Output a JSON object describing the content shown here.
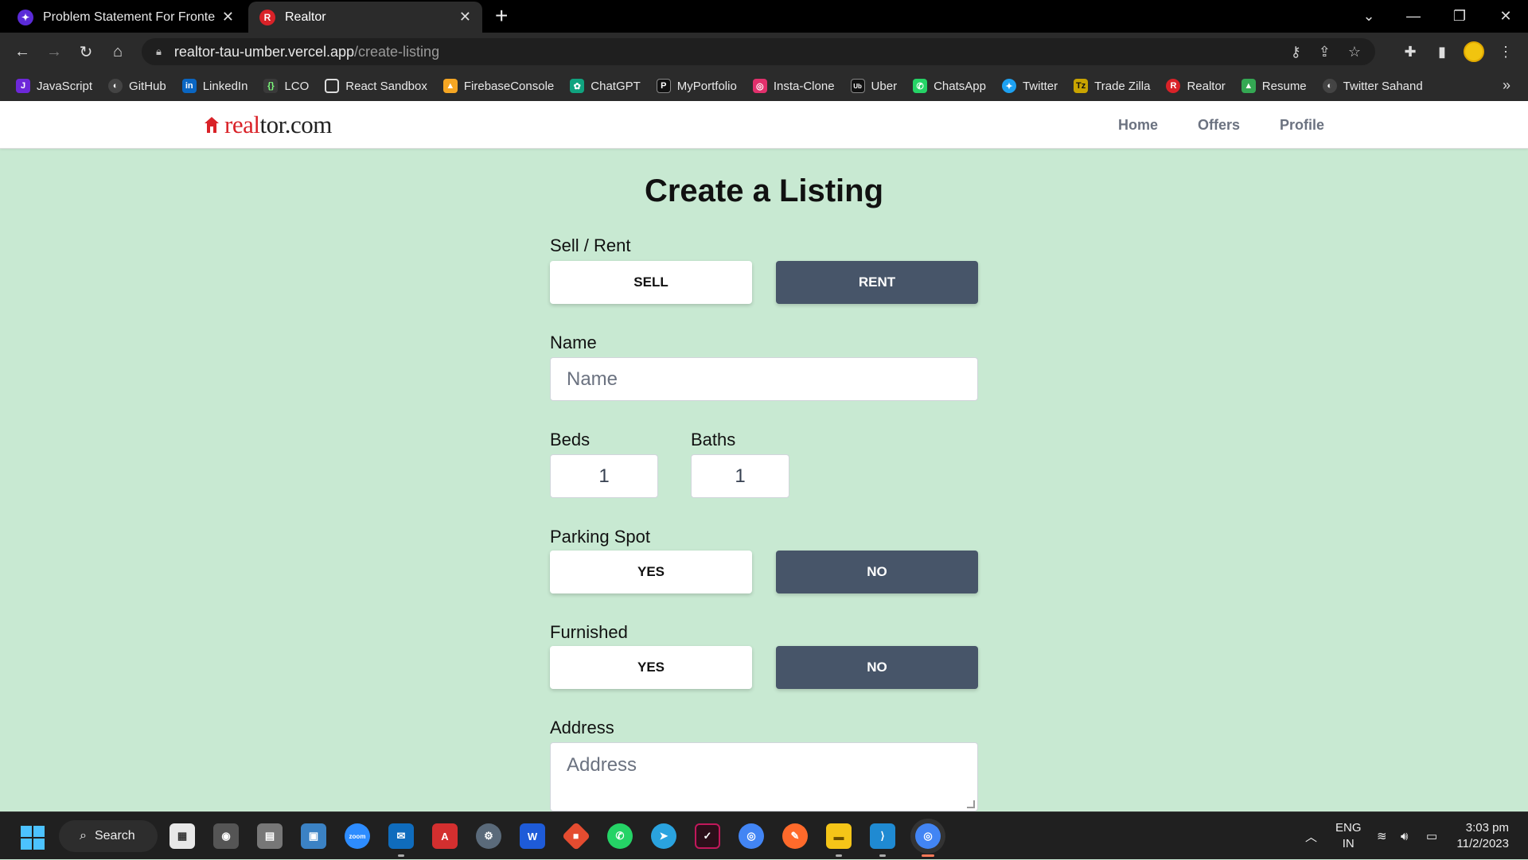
{
  "browser": {
    "tabs": [
      {
        "title": "Problem Statement For Frontend",
        "active": false,
        "favicon_color": "#5b2bd8"
      },
      {
        "title": "Realtor",
        "active": true,
        "favicon_color": "#d92228"
      }
    ],
    "url_host": "realtor-tau-umber.vercel.app",
    "url_path": "/create-listing",
    "bookmarks": [
      {
        "label": "JavaScript",
        "color": "#6d28d9"
      },
      {
        "label": "GitHub",
        "color": "#444"
      },
      {
        "label": "LinkedIn",
        "color": "#0a66c2"
      },
      {
        "label": "LCO",
        "color": "#3a3a3a"
      },
      {
        "label": "React Sandbox",
        "color": "#3a3a3a"
      },
      {
        "label": "FirebaseConsole",
        "color": "#f5a623"
      },
      {
        "label": "ChatGPT",
        "color": "#10a37f"
      },
      {
        "label": "MyPortfolio",
        "color": "#111"
      },
      {
        "label": "Insta-Clone",
        "color": "#e1306c"
      },
      {
        "label": "Uber",
        "color": "#111"
      },
      {
        "label": "ChatsApp",
        "color": "#25d366"
      },
      {
        "label": "Twitter",
        "color": "#1da1f2"
      },
      {
        "label": "Trade Zilla",
        "color": "#c9a400"
      },
      {
        "label": "Realtor",
        "color": "#d92228"
      },
      {
        "label": "Resume",
        "color": "#34a853"
      },
      {
        "label": "Twitter Sahand",
        "color": "#444"
      }
    ]
  },
  "site": {
    "logo_red": "real",
    "logo_dark": "tor.com",
    "nav": [
      "Home",
      "Offers",
      "Profile"
    ]
  },
  "form": {
    "title": "Create a Listing",
    "type_label": "Sell / Rent",
    "type_options": [
      "SELL",
      "RENT"
    ],
    "name_label": "Name",
    "name_placeholder": "Name",
    "beds_label": "Beds",
    "beds_value": "1",
    "baths_label": "Baths",
    "baths_value": "1",
    "parking_label": "Parking Spot",
    "parking_options": [
      "YES",
      "NO"
    ],
    "furnished_label": "Furnished",
    "furnished_options": [
      "YES",
      "NO"
    ],
    "address_label": "Address",
    "address_placeholder": "Address"
  },
  "taskbar": {
    "search_label": "Search",
    "lang_top": "ENG",
    "lang_bottom": "IN",
    "time": "3:03 pm",
    "date": "11/2/2023"
  },
  "colors": {
    "page_bg": "#c8e9d2",
    "toggle_dark": "#475569",
    "brand_red": "#d92228"
  }
}
